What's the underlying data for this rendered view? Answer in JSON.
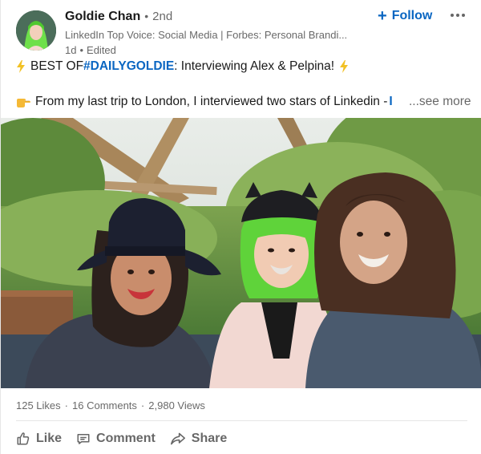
{
  "post": {
    "actor": {
      "name": "Goldie Chan",
      "dot": "•",
      "degree": "2nd",
      "headline": "LinkedIn Top Voice: Social Media | Forbes: Personal Brandi...",
      "time": "1d",
      "meta_dot": "•",
      "edited": "Edited"
    },
    "follow": {
      "plus": "+",
      "label": "Follow"
    },
    "commentary": {
      "line1_prefix": "BEST OF ",
      "line1_hashtag": "#DAILYGOLDIE",
      "line1_suffix": ": Interviewing Alex & Pelpina!",
      "line2_text": "From my last trip to London, I interviewed two stars of Linkedin - ",
      "line2_trunc": "I",
      "see_more": "...see more"
    },
    "counts": {
      "likes": "125 Likes",
      "comments": "16 Comments",
      "views": "2,980 Views",
      "sep": "·"
    },
    "actions": {
      "like": "Like",
      "comment": "Comment",
      "share": "Share"
    },
    "icons": {
      "bolt": "high-voltage-icon",
      "hand": "backhand-index-pointing-right-icon",
      "more": "more-options-icon",
      "like": "thumbs-up-icon",
      "comment": "comment-icon",
      "share": "share-arrow-icon"
    },
    "colors": {
      "link_blue": "#0a66c2",
      "bolt_yellow": "#f2c124",
      "hair_green": "#5fd33a"
    }
  }
}
